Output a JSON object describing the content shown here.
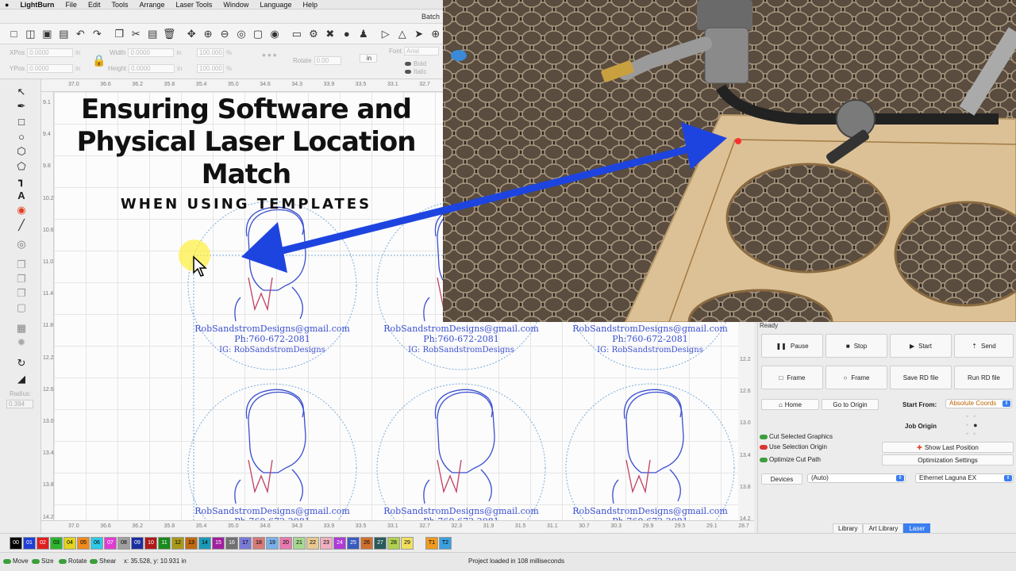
{
  "menubar": {
    "apple": "",
    "app": "LightBurn",
    "items": [
      "File",
      "Edit",
      "Tools",
      "Arrange",
      "Laser Tools",
      "Window",
      "Language",
      "Help"
    ]
  },
  "window": {
    "title": "Batch"
  },
  "props": {
    "xpos_label": "XPos",
    "xpos_value": "0.0000",
    "ypos_label": "YPos",
    "ypos_value": "0.0000",
    "unit": "in",
    "width_label": "Width",
    "width_value": "0.0000",
    "height_label": "Height",
    "height_value": "0.0000",
    "pct_w": "100.000",
    "pct_h": "100.000",
    "pct": "%",
    "rotate_label": "Rotate",
    "rotate_value": "0.00",
    "in_button": "in",
    "font_label": "Font",
    "font_value": "Arial",
    "bold": "Bold",
    "italic": "Italic"
  },
  "left_tools": {
    "radius_label": "Radius:",
    "radius_value": "0.394"
  },
  "ruler": {
    "top": [
      "37.0",
      "36.6",
      "36.2",
      "35.8",
      "35.4",
      "35.0",
      "34.6",
      "34.3",
      "33.9",
      "33.5",
      "33.1",
      "32.7"
    ],
    "left": [
      "9.1",
      "9.4",
      "9.8",
      "10.2",
      "10.6",
      "11.0",
      "11.4",
      "11.8",
      "12.2",
      "12.6",
      "13.0",
      "13.4",
      "13.8",
      "14.2"
    ],
    "right": [
      "12.2",
      "12.6",
      "13.0",
      "13.4",
      "13.8",
      "14.2"
    ],
    "bottom": [
      "37.0",
      "36.6",
      "36.2",
      "35.8",
      "35.4",
      "35.0",
      "34.6",
      "34.3",
      "33.9",
      "33.5",
      "33.1",
      "32.7",
      "32.3",
      "31.9",
      "31.5",
      "31.1",
      "30.7",
      "30.3",
      "29.9",
      "29.5",
      "29.1",
      "28.7"
    ]
  },
  "overlay": {
    "title": "Ensuring Software and Physical Laser Location Match",
    "subtitle": "WHEN USING TEMPLATES"
  },
  "design": {
    "email": "RobSandstromDesigns@gmail.com",
    "phone": "Ph:760-672-2081",
    "ig": "IG: RobSandstromDesigns"
  },
  "laser": {
    "status": "Ready",
    "pause": "Pause",
    "stop": "Stop",
    "start": "Start",
    "send": "Send",
    "frame1": "Frame",
    "frame2": "Frame",
    "save_rd": "Save RD file",
    "run_rd": "Run RD file",
    "home": "Home",
    "go_origin": "Go to Origin",
    "start_from_label": "Start From:",
    "start_from_value": "Absolute Coords",
    "job_origin_label": "Job Origin",
    "cut_selected": "Cut Selected Graphics",
    "use_selection_origin": "Use Selection Origin",
    "optimize_cut": "Optimize Cut Path",
    "show_last": "Show Last Position",
    "opt_settings": "Optimization Settings",
    "devices": "Devices",
    "auto": "(Auto)",
    "device_value": "Ethernet Laguna EX"
  },
  "tabs": [
    "Library",
    "Art Library",
    "Laser"
  ],
  "palette": [
    {
      "label": "00",
      "color": "#000000",
      "text": "#ffffff"
    },
    {
      "label": "01",
      "color": "#1f3fd8",
      "text": "#ffffff"
    },
    {
      "label": "02",
      "color": "#e02020",
      "text": "#ffffff"
    },
    {
      "label": "03",
      "color": "#2fb52f",
      "text": "#000000"
    },
    {
      "label": "04",
      "color": "#e2d41c",
      "text": "#000000"
    },
    {
      "label": "05",
      "color": "#f08a1d",
      "text": "#000000"
    },
    {
      "label": "06",
      "color": "#2ec9e8",
      "text": "#000000"
    },
    {
      "label": "07",
      "color": "#e03cd4",
      "text": "#ffffff"
    },
    {
      "label": "08",
      "color": "#a0a0a0",
      "text": "#000000"
    },
    {
      "label": "09",
      "color": "#1a2fa0",
      "text": "#ffffff"
    },
    {
      "label": "10",
      "color": "#b01a1a",
      "text": "#ffffff"
    },
    {
      "label": "11",
      "color": "#1a8a1a",
      "text": "#ffffff"
    },
    {
      "label": "12",
      "color": "#a89a18",
      "text": "#000000"
    },
    {
      "label": "13",
      "color": "#c06a10",
      "text": "#000000"
    },
    {
      "label": "14",
      "color": "#1a9ab8",
      "text": "#000000"
    },
    {
      "label": "15",
      "color": "#a020a0",
      "text": "#ffffff"
    },
    {
      "label": "16",
      "color": "#707070",
      "text": "#ffffff"
    },
    {
      "label": "17",
      "color": "#7a7ad8",
      "text": "#000000"
    },
    {
      "label": "18",
      "color": "#d87a7a",
      "text": "#000000"
    },
    {
      "label": "19",
      "color": "#7ab0e8",
      "text": "#000000"
    },
    {
      "label": "20",
      "color": "#e87ab0",
      "text": "#000000"
    },
    {
      "label": "21",
      "color": "#a8d890",
      "text": "#000000"
    },
    {
      "label": "22",
      "color": "#e8c890",
      "text": "#000000"
    },
    {
      "label": "23",
      "color": "#f0b0c0",
      "text": "#000000"
    },
    {
      "label": "24",
      "color": "#b03ad8",
      "text": "#ffffff"
    },
    {
      "label": "25",
      "color": "#3a5ac0",
      "text": "#ffffff"
    },
    {
      "label": "26",
      "color": "#d07030",
      "text": "#000000"
    },
    {
      "label": "27",
      "color": "#2a5a5a",
      "text": "#ffffff"
    },
    {
      "label": "28",
      "color": "#b0d050",
      "text": "#000000"
    },
    {
      "label": "29",
      "color": "#f0e060",
      "text": "#000000"
    },
    {
      "label": "T1",
      "color": "#f09a20",
      "text": "#000000"
    },
    {
      "label": "T2",
      "color": "#3aa0e0",
      "text": "#000000"
    }
  ],
  "status": {
    "move": "Move",
    "size": "Size",
    "rotate": "Rotate",
    "shear": "Shear",
    "coords": "x: 35.528, y: 10.931 in",
    "message": "Project loaded in 108 milliseconds"
  },
  "colors": {
    "accent": "#3b7ef0",
    "arrow": "#1e44e0",
    "design_stroke": "#3a4fd0"
  }
}
